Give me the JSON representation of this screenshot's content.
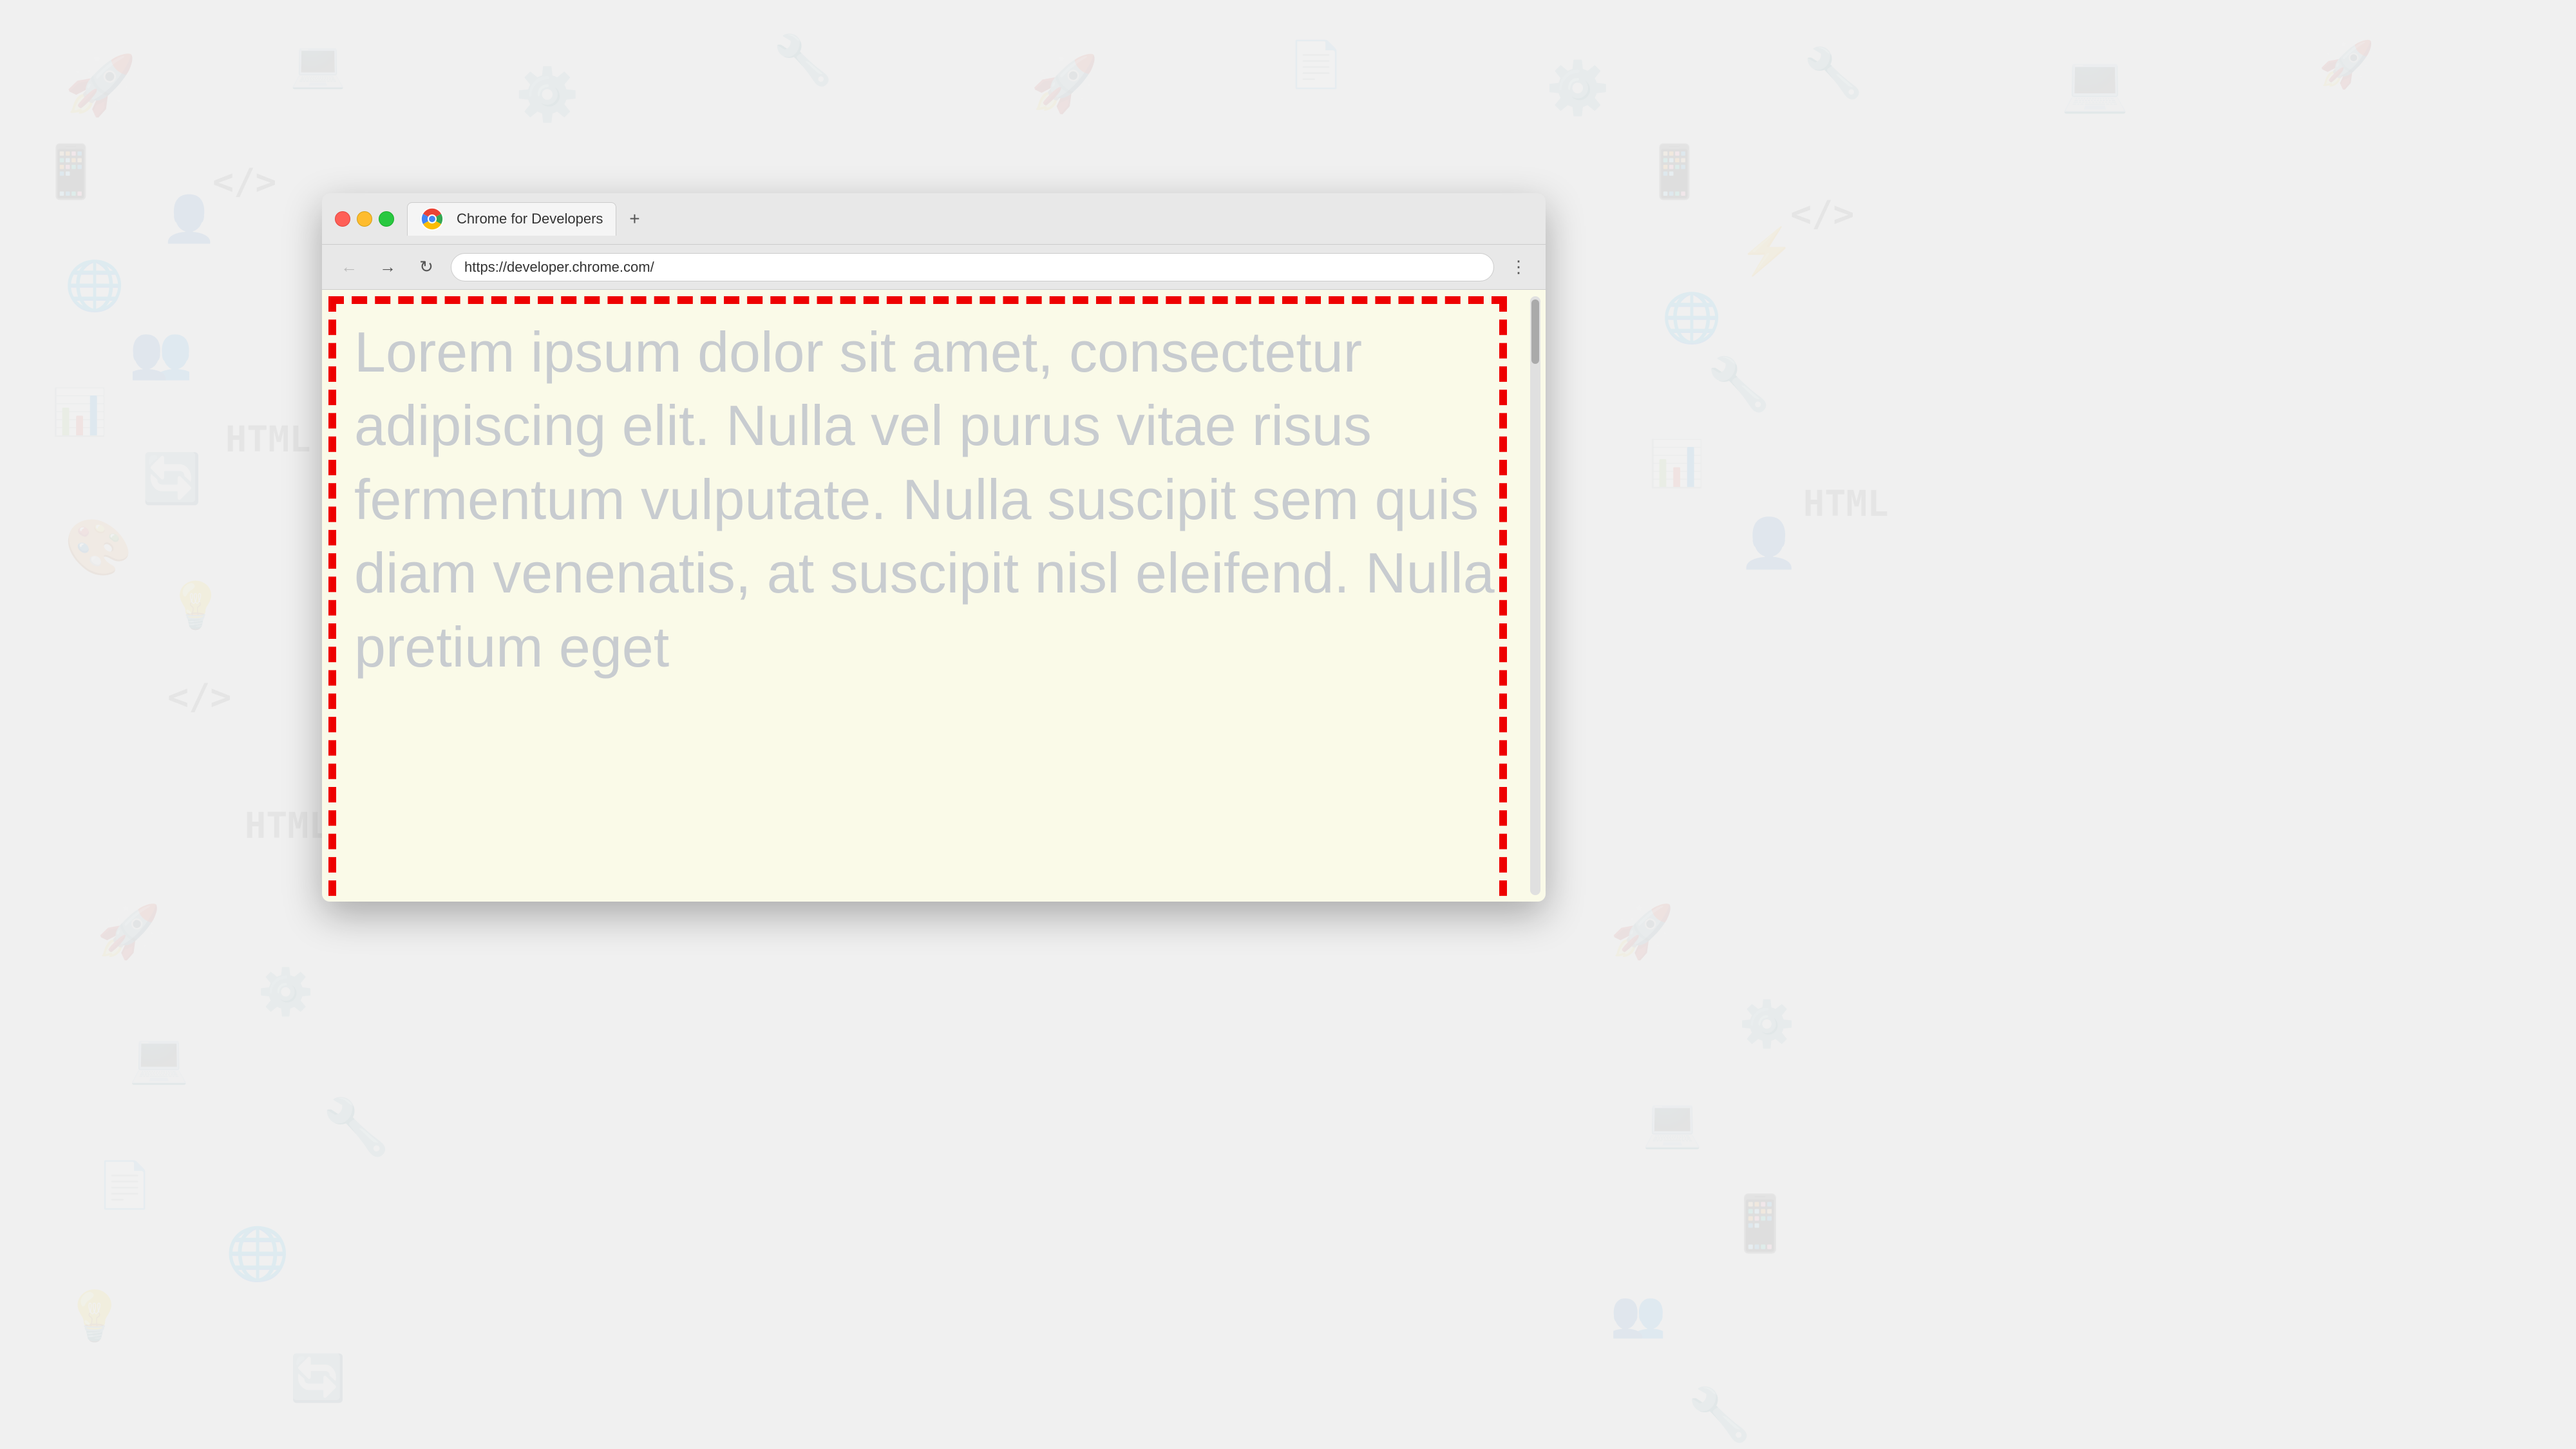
{
  "background": {
    "color": "#f0f0f0"
  },
  "browser": {
    "tab": {
      "title": "Chrome for Developers",
      "new_tab_label": "+"
    },
    "nav": {
      "back_label": "←",
      "forward_label": "→",
      "reload_label": "↻",
      "url": "https://developer.chrome.com/",
      "menu_label": "⋮"
    },
    "content": {
      "lorem_text": "Lorem ipsum dolor sit amet, consectetur adipiscing elit. Nulla vel purus vitae risus fermentum vulputate. Nulla suscipit sem quis diam venenatis, at suscipit nisl eleifend. Nulla pretium eget"
    }
  }
}
